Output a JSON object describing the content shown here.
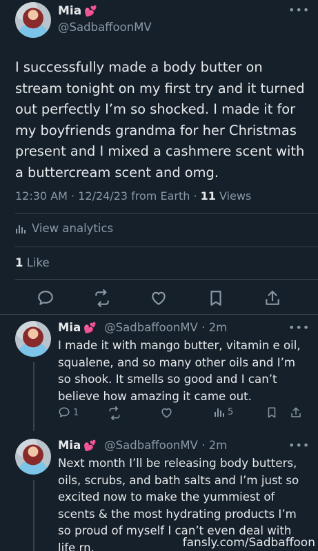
{
  "tweet": {
    "author_name": "Mia",
    "heart": "💕",
    "handle": "@SadbaffoonMV",
    "text": "I successfully made a body butter on stream tonight on my first try and it turned out perfectly I’m so shocked. I made it for my boyfriends grandma for her Christmas present and I mixed a cashmere scent with a buttercream scent and omg.",
    "timestamp": "12:30 AM · 12/24/23 from Earth · ",
    "views_count": "11",
    "views_label": " Views",
    "analytics_label": "View analytics",
    "likes_count": "1",
    "likes_label": " Like"
  },
  "replies": [
    {
      "author_name": "Mia",
      "heart": "💕",
      "handle_time": "@SadbaffoonMV · 2m",
      "text": "I made it with mango butter, vitamin e oil, squalene, and so many other oils and I’m so shook. It smells so good and I can’t believe how amazing it came out.",
      "reply_count": "1",
      "view_count": "5"
    },
    {
      "author_name": "Mia",
      "heart": "💕",
      "handle_time": "@SadbaffoonMV · 2m",
      "text": "Next month I’ll be releasing body butters, oils, scrubs, and bath salts and I’m just so excited now to make the yummiest of scents & the most hydrating products I’m so proud of myself I can’t even deal with life rn."
    }
  ],
  "watermark": "fansly.com/Sadbaffoon",
  "colors": {
    "background": "#15202b",
    "text": "#e7e9ea",
    "muted": "#8b98a5",
    "divider": "#38444d",
    "heart": "#f2439a"
  },
  "icons": [
    "more-icon",
    "reply-icon",
    "retweet-icon",
    "like-icon",
    "bookmark-icon",
    "share-icon",
    "analytics-icon"
  ]
}
